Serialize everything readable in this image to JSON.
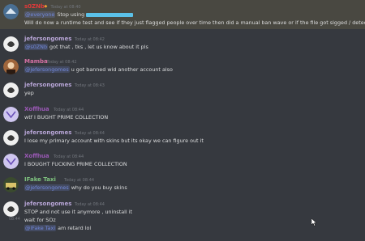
{
  "colors": {
    "background": "#36393f",
    "highlight_bg": "#494841",
    "mention": "#7289da",
    "timestamp": "#72767d",
    "text": "#dcddde"
  },
  "messages": [
    {
      "author": "s0ZNb",
      "author_color": "#e03a3a",
      "timestamp": "Today at 08:40",
      "badge": "◆",
      "lines": [
        {
          "mention": "@everyone",
          "text": " Stop using",
          "redacted": true
        },
        {
          "text": "Will do now a runtime test and see if they just flagged people over time then did a manual ban wave or if the file got sigged / detected."
        }
      ]
    },
    {
      "author": "jefersongomes",
      "author_color": "#b7a5d6",
      "timestamp": "Today at 08:42",
      "lines": [
        {
          "mention": "@s0ZNb",
          "text": " got that , tks , let us know about it pls"
        }
      ]
    },
    {
      "author": "Mamba",
      "author_color": "#d671a4",
      "timestamp": "Today at 08:42",
      "lines": [
        {
          "mention": "@jefersongomes",
          "text": " u got banned wid another account also"
        }
      ]
    },
    {
      "author": "jefersongomes",
      "author_color": "#b7a5d6",
      "timestamp": "Today at 08:43",
      "lines": [
        {
          "text": "yep"
        }
      ]
    },
    {
      "author": "Xoffhua",
      "author_color": "#9b59b6",
      "timestamp": "Today at 08:44",
      "lines": [
        {
          "text": "wtf I BUGHT PRIME COLLECTION"
        }
      ]
    },
    {
      "author": "jefersongomes",
      "author_color": "#b7a5d6",
      "timestamp": "Today at 08:44",
      "lines": [
        {
          "text": "I lose my primary account with skins but its okay we can figure out it"
        }
      ]
    },
    {
      "author": "Xoffhua",
      "author_color": "#9b59b6",
      "timestamp": "Today at 08:44",
      "lines": [
        {
          "text": "I BOUGHT FUCKING PRIME COLLECTION"
        }
      ]
    },
    {
      "author": "IFake Taxi",
      "author_color": "#7ec27e",
      "timestamp": "Today at 08:44",
      "lines": [
        {
          "mention": "@jefersongomes",
          "text": " why do you buy skins"
        }
      ]
    },
    {
      "author": "jefersongomes",
      "author_color": "#b7a5d6",
      "timestamp": "Today at 08:44",
      "lines": [
        {
          "text": "STOP and not use it anymore , uninstall it"
        },
        {
          "side_time": "08:44",
          "text": "wait for SOz"
        },
        {
          "mention": "@IFake Taxi",
          "text": " am retard lol"
        }
      ]
    }
  ]
}
